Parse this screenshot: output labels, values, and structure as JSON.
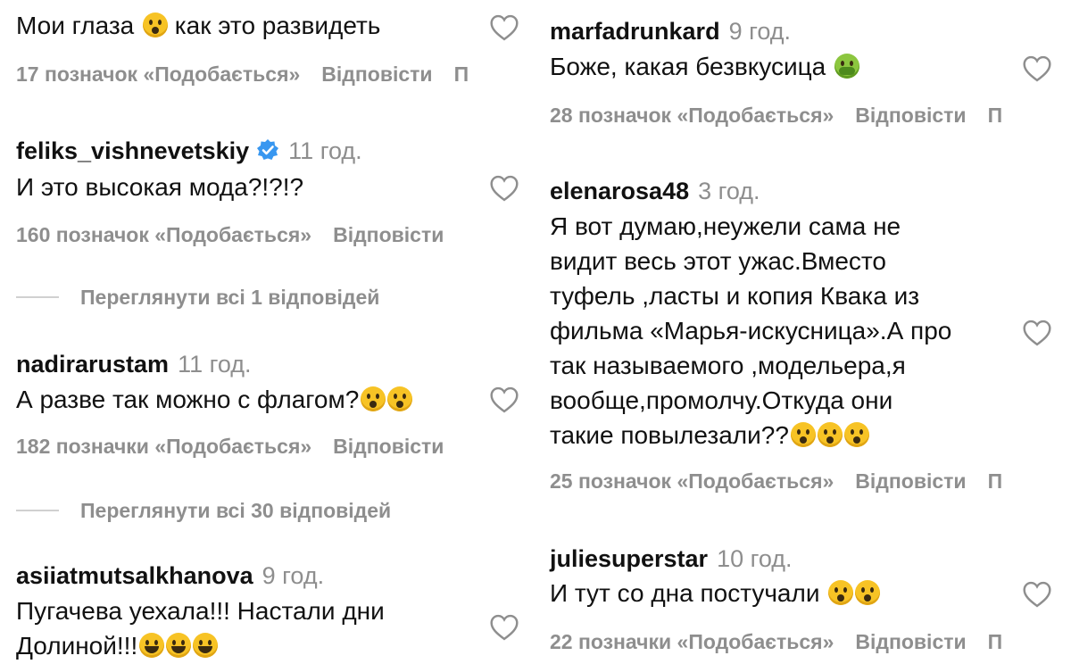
{
  "heart_icon": "heart-outline-icon",
  "verified_icon": "verified-badge-icon",
  "colors": {
    "secondary_text": "#8e8e8e",
    "primary_text": "#111111",
    "verified": "#3897f0"
  },
  "left": {
    "c0": {
      "text": "Мои глаза",
      "text2": "как это развидеть",
      "likes": "17 позначок «Подобається»",
      "reply": "Відповісти",
      "extra": "П"
    },
    "c1": {
      "username": "feliks_vishnevetskiy",
      "time": "11 год.",
      "text": "И это высокая мода?!?!?",
      "likes": "160 позначок «Подобається»",
      "reply": "Відповісти",
      "view_replies": "Переглянути всі 1 відповідей"
    },
    "c2": {
      "username": "nadirarustam",
      "time": "11 год.",
      "text": "А разве так можно с флагом?",
      "likes": "182 позначки «Подобається»",
      "reply": "Відповісти",
      "view_replies": "Переглянути всі 30 відповідей"
    },
    "c3": {
      "username": "asiiatmutsalkhanova",
      "time": "9 год.",
      "text_line1": "Пугачева уехала!!! Настали дни",
      "text_line2": "Долиной!!!"
    }
  },
  "right": {
    "c0": {
      "username": "marfadrunkard",
      "time": "9 год.",
      "text": "Боже, какая безвкусица",
      "likes": "28 позначок «Подобається»",
      "reply": "Відповісти",
      "extra": "П"
    },
    "c1": {
      "username": "elenarosa48",
      "time": "3 год.",
      "lines": [
        "Я вот думаю,неужели сама не",
        "видит весь этот ужас.Вместо",
        "туфель ,ласты и копия Квака из",
        "фильма «Марья-искусница».А про",
        "так называемого ,модельера,я",
        "вообще,промолчу.Откуда они",
        "такие повылезали??"
      ],
      "likes": "25 позначок «Подобається»",
      "reply": "Відповісти",
      "extra": "П"
    },
    "c2": {
      "username": "juliesuperstar",
      "time": "10 год.",
      "text": "И тут со дна постучали",
      "likes": "22 позначки «Подобається»",
      "reply": "Відповісти",
      "extra": "П"
    }
  }
}
